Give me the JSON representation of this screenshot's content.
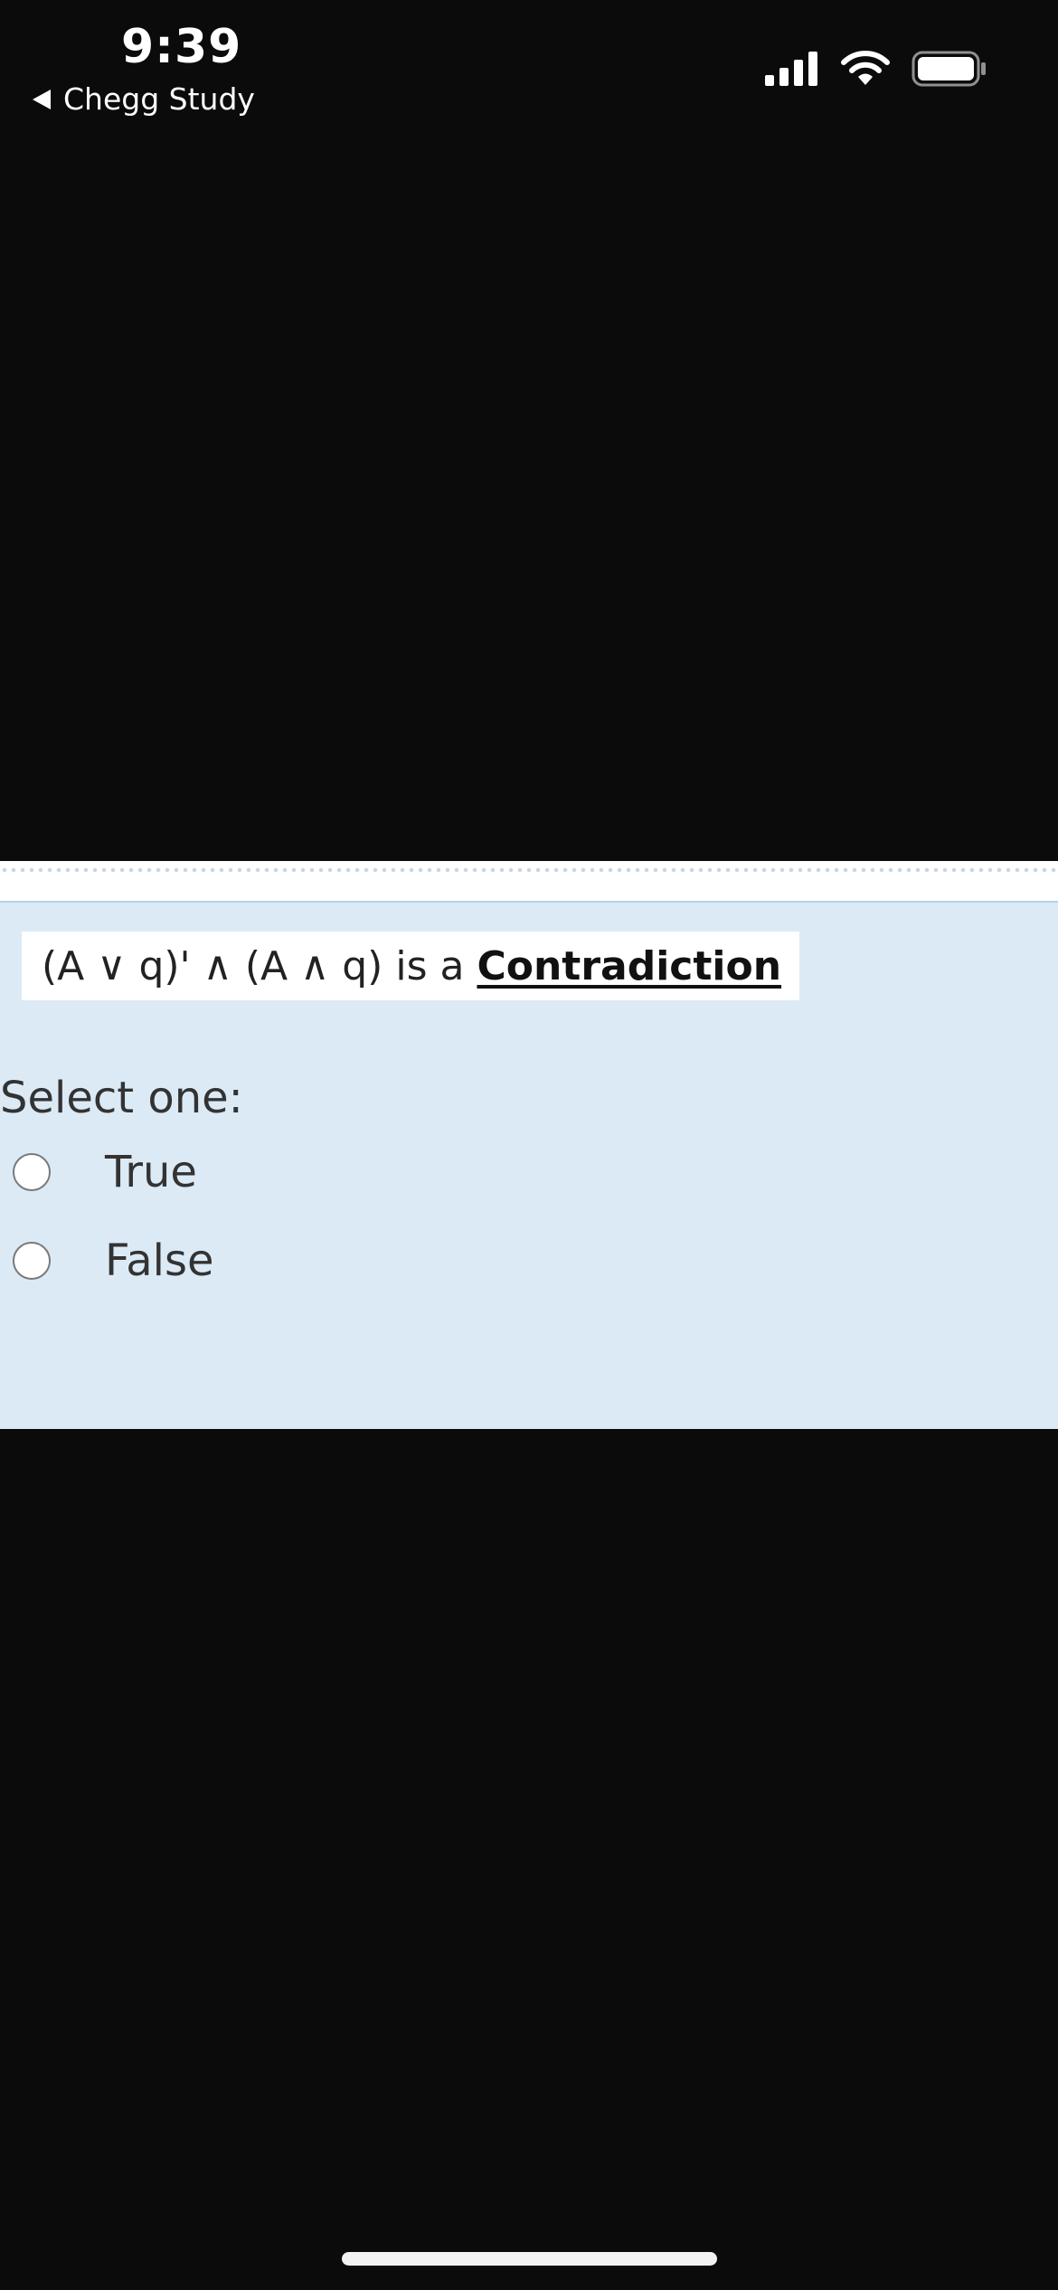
{
  "status_bar": {
    "time": "9:39",
    "back_label": "Chegg Study",
    "icons": [
      "signal-icon",
      "wifi-icon",
      "battery-icon"
    ]
  },
  "question": {
    "statement": "(A ∨ q)' ∧ (A ∧ q) is a",
    "term": "Contradiction"
  },
  "answer": {
    "prompt": "Select one:",
    "options": [
      {
        "label": "True",
        "selected": false
      },
      {
        "label": "False",
        "selected": false
      }
    ]
  },
  "colors": {
    "background": "#0b0b0b",
    "panel": "#dceaf6",
    "text": "#333333"
  }
}
